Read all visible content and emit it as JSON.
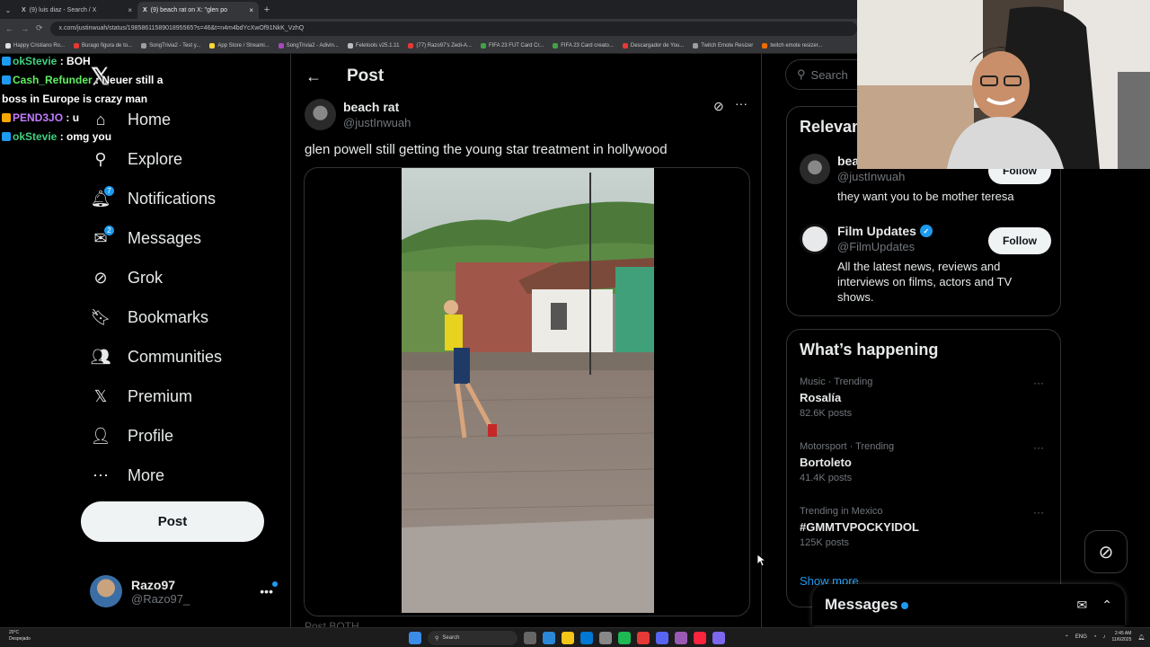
{
  "browser": {
    "tabs": [
      {
        "label": "(9) luis diaz - Search / X",
        "close": "×"
      },
      {
        "label": "(9) beach rat on X: \"glen po",
        "close": "×"
      }
    ],
    "new_tab": "+",
    "tab_menu": "⌄",
    "nav": {
      "back": "←",
      "forward": "→",
      "reload": "⟳"
    },
    "url": "x.com/justinwuah/status/1985861158901895565?s=46&t=n4m4bdYcXwOf91NkK_VzhQ",
    "bookmarks": [
      {
        "label": "Happy Cristiano Ro...",
        "color": "#e0e0e0"
      },
      {
        "label": "Burago figura de to...",
        "color": "#e53935"
      },
      {
        "label": "SongTrivia2 - Test y...",
        "color": "#9e9e9e"
      },
      {
        "label": "App Store / Streami...",
        "color": "#fdd835"
      },
      {
        "label": "SongTrivia2 - Adivin...",
        "color": "#ab47bc"
      },
      {
        "label": "Feletools v25.1.11",
        "color": "#bdbdbd"
      },
      {
        "label": "(77) Razo97's Zedi-A...",
        "color": "#e53935"
      },
      {
        "label": "FIFA 23 FUT Card Cr...",
        "color": "#43a047"
      },
      {
        "label": "FIFA 23 Card creato...",
        "color": "#43a047"
      },
      {
        "label": "Descargador de You...",
        "color": "#e53935"
      },
      {
        "label": "Twitch Emote Resizer",
        "color": "#9e9e9e"
      },
      {
        "label": "twitch emote resizer...",
        "color": "#ef6c00"
      }
    ]
  },
  "chat": [
    {
      "user": "okStevie",
      "color": "#3fd17f",
      "msg": " : BOH",
      "badge": "#1d9bf0"
    },
    {
      "user": "Cash_Refunder",
      "color": "#5ff05f",
      "msg": " : Neuer still a boss in Europe is crazy man",
      "badge": "#1d9bf0"
    },
    {
      "user": "PEND3JO",
      "color": "#c27cff",
      "msg": " : u",
      "badge": "#f6a700"
    },
    {
      "user": "okStevie",
      "color": "#3fd17f",
      "msg": " : omg you",
      "badge": "#1d9bf0"
    }
  ],
  "sidebar": {
    "logo": "𝕏",
    "items": [
      {
        "label": "Home",
        "icon": "home-icon",
        "glyph": "⌂"
      },
      {
        "label": "Explore",
        "icon": "search-icon",
        "glyph": "⚲"
      },
      {
        "label": "Notifications",
        "icon": "bell-icon",
        "glyph": "🔔︎",
        "badge": "7"
      },
      {
        "label": "Messages",
        "icon": "mail-icon",
        "glyph": "✉",
        "badge": "2"
      },
      {
        "label": "Grok",
        "icon": "grok-icon",
        "glyph": "⊘"
      },
      {
        "label": "Bookmarks",
        "icon": "bookmark-icon",
        "glyph": "🔖︎"
      },
      {
        "label": "Communities",
        "icon": "communities-icon",
        "glyph": "👥︎"
      },
      {
        "label": "Premium",
        "icon": "x-premium-icon",
        "glyph": "𝕏"
      },
      {
        "label": "Profile",
        "icon": "profile-icon",
        "glyph": "👤︎"
      },
      {
        "label": "More",
        "icon": "more-circle-icon",
        "glyph": "⋯"
      }
    ],
    "post_button": "Post",
    "account": {
      "name": "Razo97",
      "handle": "@Razo97_",
      "more": "•••"
    }
  },
  "post": {
    "header_back": "←",
    "header_title": "Post",
    "author_name": "beach rat",
    "author_handle": "@justInwuah",
    "grok_glyph": "⊘",
    "more_glyph": "···",
    "text": "glen powell still getting the young star treatment in hollywood",
    "next_preview": "Post BOTH"
  },
  "right": {
    "search_placeholder": "Search",
    "search_glyph": "⚲",
    "relevant": {
      "title": "Relevant people",
      "people": [
        {
          "name": "beach rat",
          "handle": "@justInwuah",
          "bio": "they want you to be mother teresa",
          "follow": "Follow",
          "verified": false
        },
        {
          "name": "Film Updates",
          "handle": "@FilmUpdates",
          "bio": "All the latest news, reviews and interviews on films, actors and TV shows.",
          "follow": "Follow",
          "verified": true
        }
      ]
    },
    "happening": {
      "title": "What’s happening",
      "trends": [
        {
          "context": "Music · Trending",
          "name": "Rosalía",
          "count": "82.6K posts"
        },
        {
          "context": "Motorsport · Trending",
          "name": "Bortoleto",
          "count": "41.4K posts"
        },
        {
          "context": "Trending in Mexico",
          "name": "#GMMTVPOCKYIDOL",
          "count": "125K posts"
        }
      ],
      "show_more": "Show more",
      "more_glyph": "···"
    },
    "messages_drawer": {
      "title": "Messages",
      "compose_glyph": "✉",
      "expand_glyph": "⌃"
    },
    "grok_fab_glyph": "⊘"
  },
  "taskbar": {
    "weather_temp": "20°C",
    "weather_desc": "Despejado",
    "search_label": "Search",
    "lang": "ENG",
    "time": "2:45 AM",
    "date": "11/6/2025",
    "app_colors": [
      "#3c8ce7",
      "#666",
      "#2b88d8",
      "#f5c518",
      "#0078d4",
      "#888",
      "#1db954",
      "#e53935",
      "#5865f2",
      "#9b59b6",
      "#fa243c",
      "#7b68ee"
    ]
  }
}
